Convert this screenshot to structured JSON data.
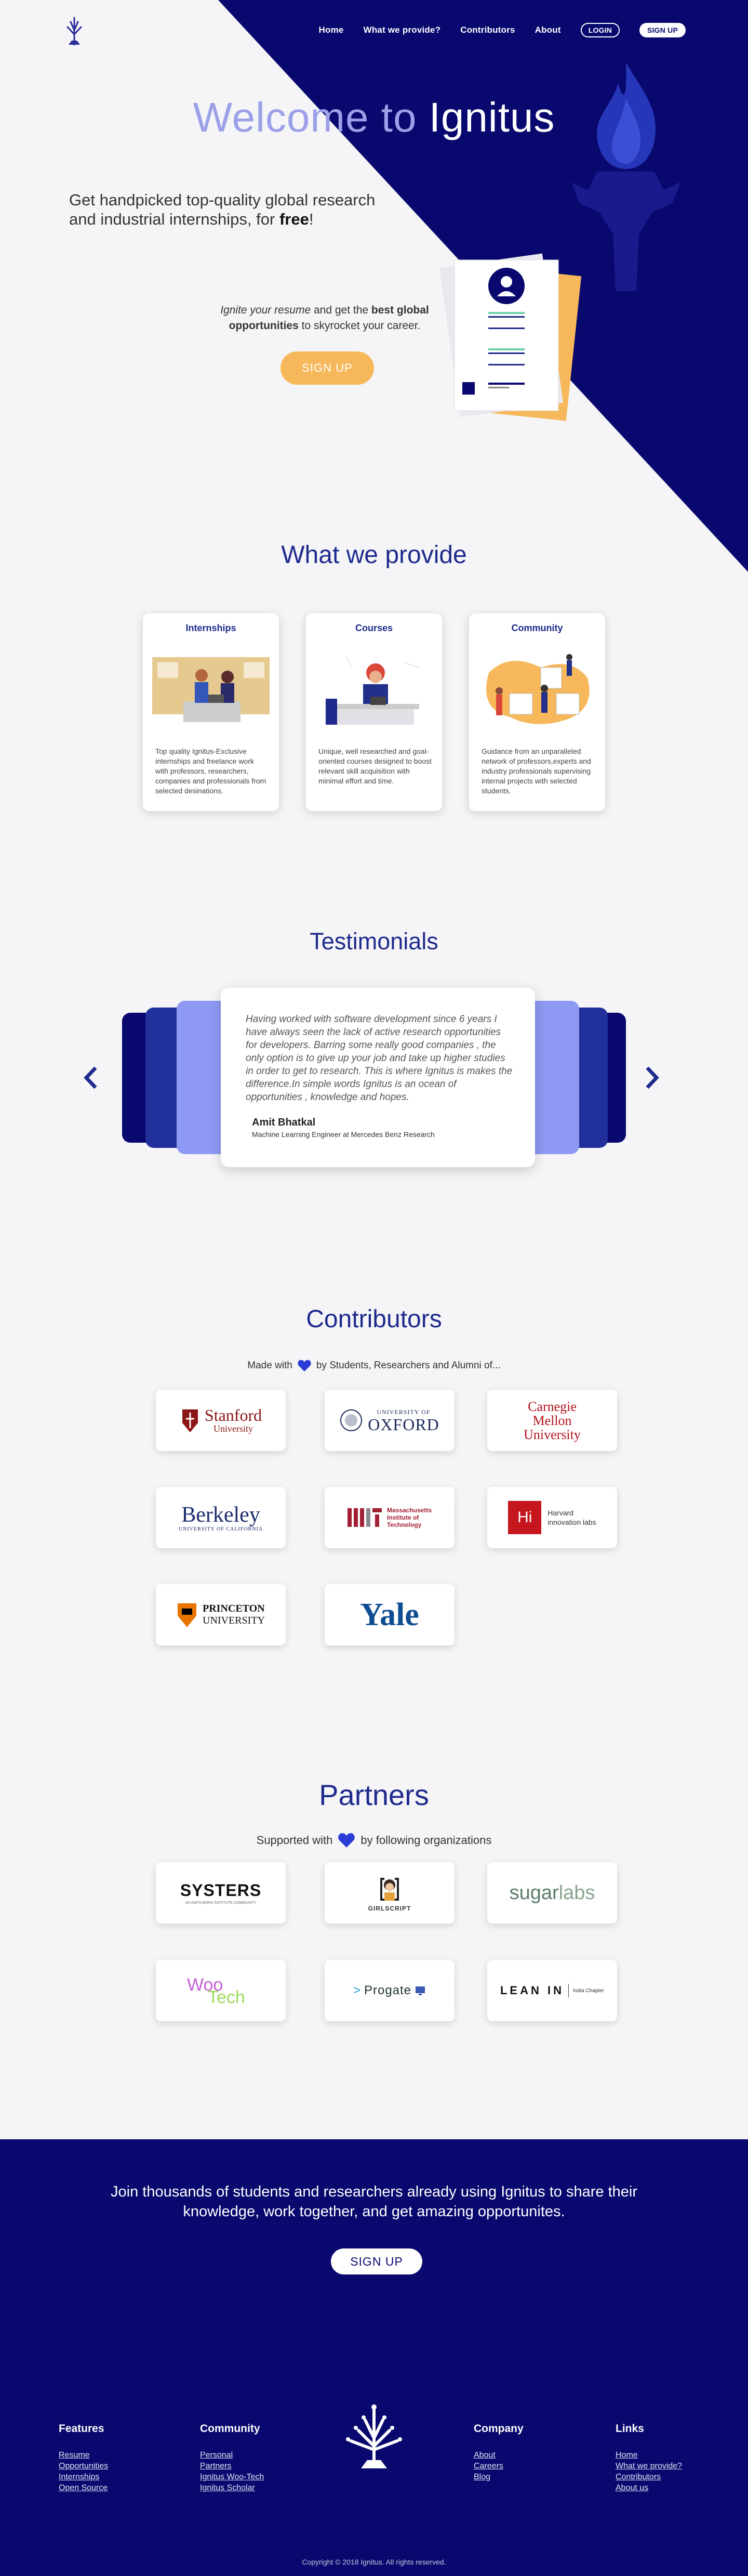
{
  "nav": {
    "home": "Home",
    "provide": "What we provide?",
    "contributors": "Contributors",
    "about": "About",
    "login": "LOGIN",
    "signup": "SIGN UP"
  },
  "hero": {
    "welcome_a": "Welcome to ",
    "welcome_b": "Ignitus",
    "tagline_a": "Get handpicked top-quality global research and industrial internships, for ",
    "tagline_b": "free",
    "tagline_c": "!",
    "resume_a": "Ignite your resume",
    "resume_b": " and get the ",
    "resume_c": "best global opportunities",
    "resume_d": " to skyrocket your career.",
    "signup": "SIGN UP"
  },
  "provide": {
    "title": "What we provide",
    "cards": [
      {
        "title": "Internships",
        "text": "Top quality Ignitus-Exclusive internships and freelance work with professors, researchers, companies and professionals from selected desinations."
      },
      {
        "title": "Courses",
        "text": "Unique, well researched and goal-oriented courses designed to boost relevant skill acquisition with minimal effort and time."
      },
      {
        "title": "Community",
        "text": "Guidance from an unparalleled network of professors,experts and industry professionals supervising internal projects with selected students."
      }
    ]
  },
  "testimonials": {
    "title": "Testimonials",
    "quote": "Having worked with software development since 6 years I have always seen the lack of active research opportunities for developers. Barring some really good companies , the only option is to give up your job and take up higher studies in order to get to research. This is where Ignitus is makes the difference.In simple words Ignitus is an ocean of opportunities , knowledge and hopes.",
    "author": "Amit Bhatkal",
    "role": "Machine Learning Engineer at Mercedes Benz Research"
  },
  "contributors": {
    "title": "Contributors",
    "made_a": "Made with",
    "made_b": "by Students, Researchers and Alumni of...",
    "logos": {
      "stanford": "Stanford",
      "stanford_sub": "University",
      "oxford_top": "UNIVERSITY OF",
      "oxford": "OXFORD",
      "cmu1": "Carnegie",
      "cmu2": "Mellon",
      "cmu3": "University",
      "berkeley": "Berkeley",
      "berkeley_sub": "UNIVERSITY OF CALIFORNIA",
      "mit_1": "Massachusetts",
      "mit_2": "Institute of",
      "mit_3": "Technology",
      "harvard_mark": "Hi",
      "harvard_1": "Harvard",
      "harvard_2": "innovation labs",
      "princeton_1": "PRINCETON",
      "princeton_2": "UNIVERSITY",
      "yale": "Yale"
    }
  },
  "partners": {
    "title": "Partners",
    "sup_a": "Supported with",
    "sup_b": "by following organizations",
    "logos": {
      "systers": "SYSTERS",
      "systers_sub": "AN ANITA BORG INSTITUTE COMMUNITY",
      "girlscript": "GIRLSCRIPT",
      "sugar_a": "sugar",
      "sugar_b": "labs",
      "woo": "Woo",
      "tech": "Tech",
      "progate": "Progate",
      "leanin": "LEAN IN",
      "leanin_sub": "India Chapter"
    }
  },
  "cta": {
    "text": "Join thousands of students and researchers already using Ignitus to share their knowledge, work together, and get amazing opportunites.",
    "button": "SIGN UP"
  },
  "footer": {
    "features": {
      "title": "Features",
      "links": [
        "Resume",
        "Opportunities",
        "Internships",
        "Open Source"
      ]
    },
    "community": {
      "title": "Community",
      "links": [
        "Personal",
        "Partners",
        "Ignitus Woo-Tech",
        "Ignitus Scholar"
      ]
    },
    "company": {
      "title": "Company",
      "links": [
        "About",
        "Careers",
        "Blog"
      ]
    },
    "links": {
      "title": "Links",
      "links": [
        "Home",
        "What we provide?",
        "Contributors",
        "About us"
      ]
    },
    "copyright": "Copyright © 2018 Ignitus. All rights reserved."
  },
  "colors": {
    "navy": "#08086e",
    "accent": "#f6b85a",
    "title": "#1e2a8c",
    "heart": "#2b3bd6"
  }
}
